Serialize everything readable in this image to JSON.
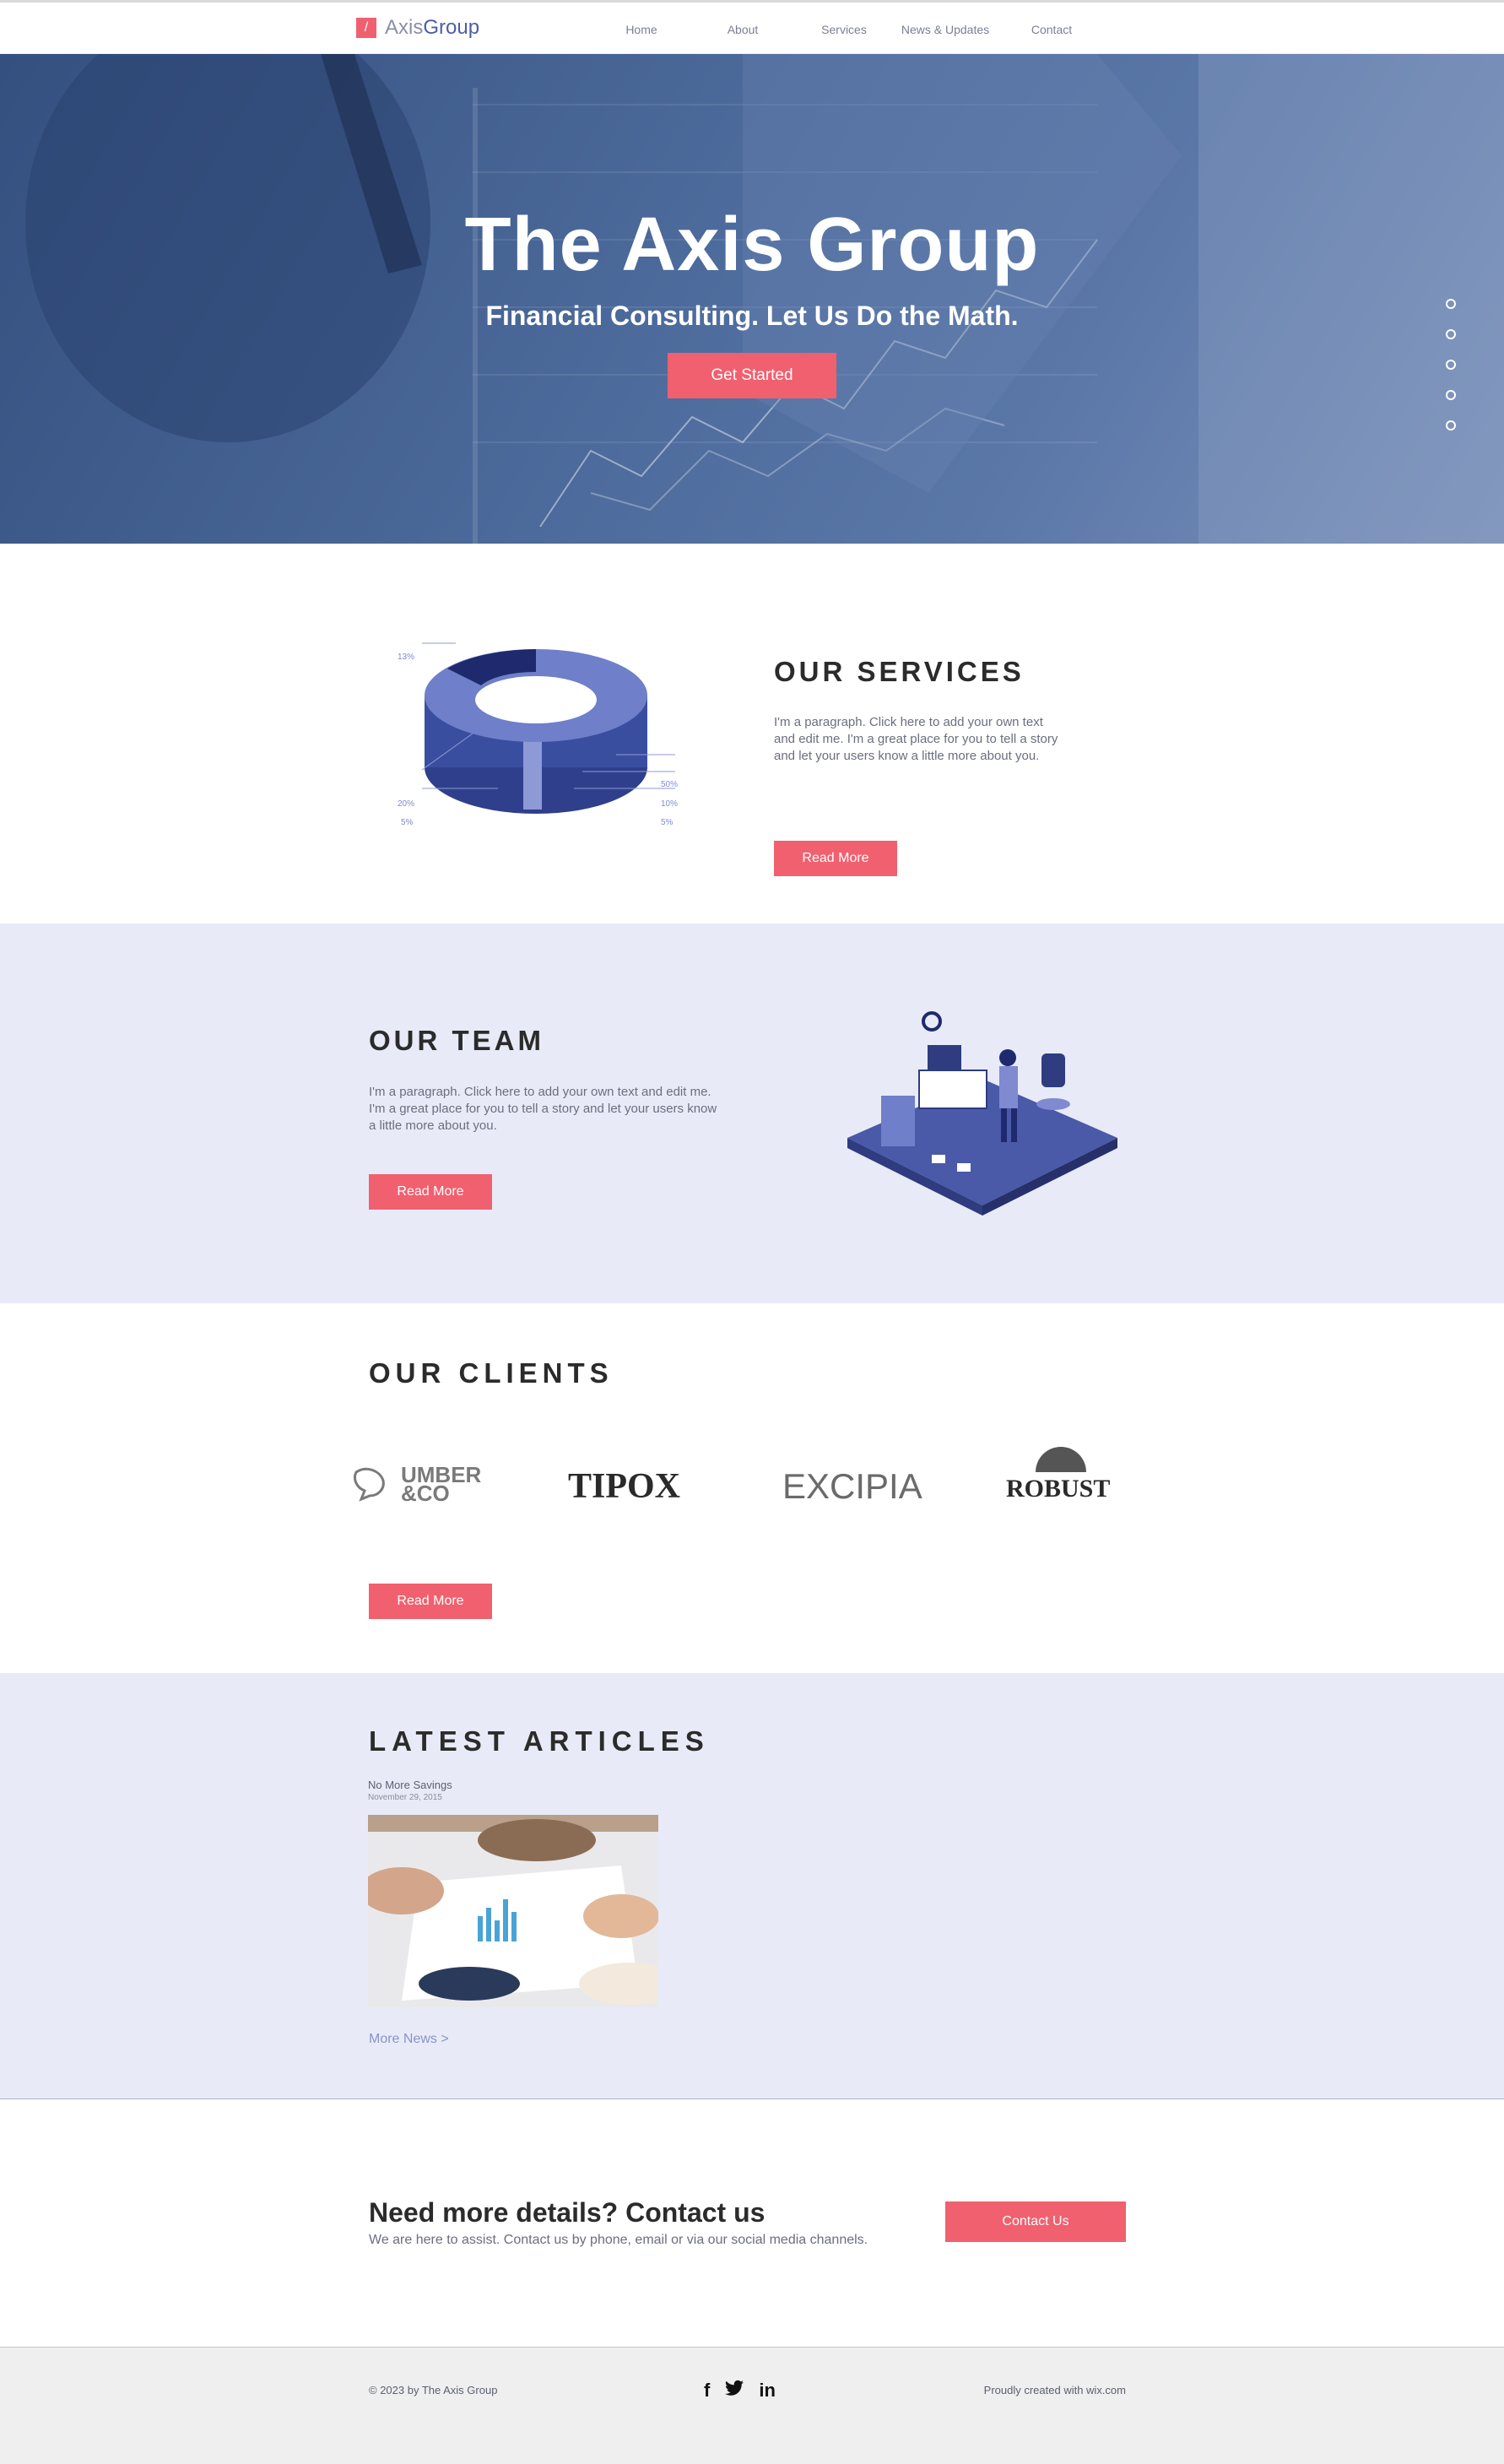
{
  "header": {
    "logo_mark": "/",
    "logo_light": "Axis",
    "logo_brand": "Group",
    "nav": [
      "Home",
      "About",
      "Services",
      "News & Updates",
      "Contact"
    ]
  },
  "hero": {
    "title": "The Axis Group",
    "subtitle": "Financial Consulting.  Let Us Do the Math.",
    "button": "Get Started"
  },
  "services": {
    "title": "OUR SERVICES",
    "paragraph": "I'm a paragraph. Click here to add your own text and edit me. I'm a great place for you to tell a story and let your users know a little more about you.",
    "button": "Read More",
    "chart_labels": [
      "13%",
      "20%",
      "5%",
      "50%",
      "10%",
      "5%"
    ]
  },
  "team": {
    "title": "OUR TEAM",
    "paragraph": "I'm a paragraph. Click here to add your own text and edit me. I'm a great place for you to tell a story and let your users know a little more about you.",
    "button": "Read More"
  },
  "clients": {
    "title": "OUR CLIENTS",
    "logos": [
      "UMBER &CO",
      "TIPOX",
      "EXCIPIA",
      "ROBUST"
    ],
    "button": "Read More"
  },
  "articles": {
    "title": "LATEST ARTICLES",
    "post_title": "No More Savings",
    "post_date": "November 29, 2015",
    "more": "More News >"
  },
  "contact": {
    "title": "Need more details? Contact us",
    "subtitle": "We are here to assist. Contact us by phone, email or via our social media channels.",
    "button": "Contact Us"
  },
  "footer": {
    "copyright": "© 2023 by The Axis Group",
    "social": [
      "f",
      "t",
      "in"
    ],
    "made": "Proudly created with wix.com"
  },
  "colors": {
    "accent": "#f0606f",
    "brand": "#4b5fa6",
    "tint": "#e8ebf7"
  }
}
